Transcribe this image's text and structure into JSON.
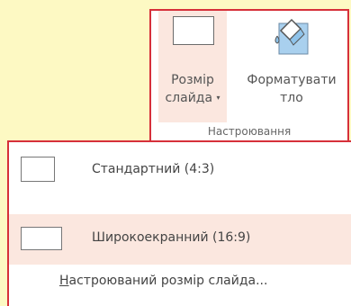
{
  "ribbon": {
    "slide_size": {
      "line1": "Розмір",
      "line2": "слайда",
      "caret": "▾",
      "icon": "slide-size-icon"
    },
    "format_background": {
      "line1": "Форматувати",
      "line2": "тло",
      "icon": "format-background-icon"
    },
    "group_label": "Настроювання"
  },
  "menu": {
    "items": [
      {
        "label": "Стандартний (4:3)",
        "icon": "standard-slide-icon"
      },
      {
        "label": "Широкоекранний (16:9)",
        "icon": "widescreen-slide-icon"
      }
    ],
    "custom": {
      "accel": "Н",
      "rest": "астроюваний розмір слайда..."
    }
  },
  "colors": {
    "highlight": "#fbe7df",
    "border": "#d6303a",
    "background": "#fdf9c3"
  }
}
